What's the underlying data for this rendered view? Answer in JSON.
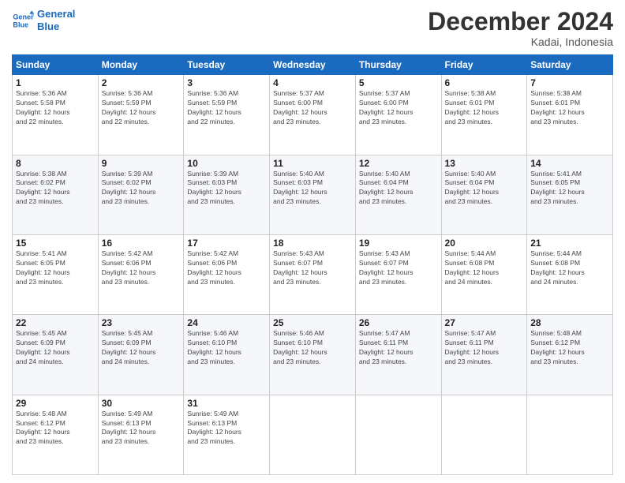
{
  "logo": {
    "line1": "General",
    "line2": "Blue"
  },
  "title": "December 2024",
  "location": "Kadai, Indonesia",
  "days_header": [
    "Sunday",
    "Monday",
    "Tuesday",
    "Wednesday",
    "Thursday",
    "Friday",
    "Saturday"
  ],
  "weeks": [
    [
      {
        "day": "1",
        "info": "Sunrise: 5:36 AM\nSunset: 5:58 PM\nDaylight: 12 hours\nand 22 minutes."
      },
      {
        "day": "2",
        "info": "Sunrise: 5:36 AM\nSunset: 5:59 PM\nDaylight: 12 hours\nand 22 minutes."
      },
      {
        "day": "3",
        "info": "Sunrise: 5:36 AM\nSunset: 5:59 PM\nDaylight: 12 hours\nand 22 minutes."
      },
      {
        "day": "4",
        "info": "Sunrise: 5:37 AM\nSunset: 6:00 PM\nDaylight: 12 hours\nand 23 minutes."
      },
      {
        "day": "5",
        "info": "Sunrise: 5:37 AM\nSunset: 6:00 PM\nDaylight: 12 hours\nand 23 minutes."
      },
      {
        "day": "6",
        "info": "Sunrise: 5:38 AM\nSunset: 6:01 PM\nDaylight: 12 hours\nand 23 minutes."
      },
      {
        "day": "7",
        "info": "Sunrise: 5:38 AM\nSunset: 6:01 PM\nDaylight: 12 hours\nand 23 minutes."
      }
    ],
    [
      {
        "day": "8",
        "info": "Sunrise: 5:38 AM\nSunset: 6:02 PM\nDaylight: 12 hours\nand 23 minutes."
      },
      {
        "day": "9",
        "info": "Sunrise: 5:39 AM\nSunset: 6:02 PM\nDaylight: 12 hours\nand 23 minutes."
      },
      {
        "day": "10",
        "info": "Sunrise: 5:39 AM\nSunset: 6:03 PM\nDaylight: 12 hours\nand 23 minutes."
      },
      {
        "day": "11",
        "info": "Sunrise: 5:40 AM\nSunset: 6:03 PM\nDaylight: 12 hours\nand 23 minutes."
      },
      {
        "day": "12",
        "info": "Sunrise: 5:40 AM\nSunset: 6:04 PM\nDaylight: 12 hours\nand 23 minutes."
      },
      {
        "day": "13",
        "info": "Sunrise: 5:40 AM\nSunset: 6:04 PM\nDaylight: 12 hours\nand 23 minutes."
      },
      {
        "day": "14",
        "info": "Sunrise: 5:41 AM\nSunset: 6:05 PM\nDaylight: 12 hours\nand 23 minutes."
      }
    ],
    [
      {
        "day": "15",
        "info": "Sunrise: 5:41 AM\nSunset: 6:05 PM\nDaylight: 12 hours\nand 23 minutes."
      },
      {
        "day": "16",
        "info": "Sunrise: 5:42 AM\nSunset: 6:06 PM\nDaylight: 12 hours\nand 23 minutes."
      },
      {
        "day": "17",
        "info": "Sunrise: 5:42 AM\nSunset: 6:06 PM\nDaylight: 12 hours\nand 23 minutes."
      },
      {
        "day": "18",
        "info": "Sunrise: 5:43 AM\nSunset: 6:07 PM\nDaylight: 12 hours\nand 23 minutes."
      },
      {
        "day": "19",
        "info": "Sunrise: 5:43 AM\nSunset: 6:07 PM\nDaylight: 12 hours\nand 23 minutes."
      },
      {
        "day": "20",
        "info": "Sunrise: 5:44 AM\nSunset: 6:08 PM\nDaylight: 12 hours\nand 24 minutes."
      },
      {
        "day": "21",
        "info": "Sunrise: 5:44 AM\nSunset: 6:08 PM\nDaylight: 12 hours\nand 24 minutes."
      }
    ],
    [
      {
        "day": "22",
        "info": "Sunrise: 5:45 AM\nSunset: 6:09 PM\nDaylight: 12 hours\nand 24 minutes."
      },
      {
        "day": "23",
        "info": "Sunrise: 5:45 AM\nSunset: 6:09 PM\nDaylight: 12 hours\nand 24 minutes."
      },
      {
        "day": "24",
        "info": "Sunrise: 5:46 AM\nSunset: 6:10 PM\nDaylight: 12 hours\nand 23 minutes."
      },
      {
        "day": "25",
        "info": "Sunrise: 5:46 AM\nSunset: 6:10 PM\nDaylight: 12 hours\nand 23 minutes."
      },
      {
        "day": "26",
        "info": "Sunrise: 5:47 AM\nSunset: 6:11 PM\nDaylight: 12 hours\nand 23 minutes."
      },
      {
        "day": "27",
        "info": "Sunrise: 5:47 AM\nSunset: 6:11 PM\nDaylight: 12 hours\nand 23 minutes."
      },
      {
        "day": "28",
        "info": "Sunrise: 5:48 AM\nSunset: 6:12 PM\nDaylight: 12 hours\nand 23 minutes."
      }
    ],
    [
      {
        "day": "29",
        "info": "Sunrise: 5:48 AM\nSunset: 6:12 PM\nDaylight: 12 hours\nand 23 minutes."
      },
      {
        "day": "30",
        "info": "Sunrise: 5:49 AM\nSunset: 6:13 PM\nDaylight: 12 hours\nand 23 minutes."
      },
      {
        "day": "31",
        "info": "Sunrise: 5:49 AM\nSunset: 6:13 PM\nDaylight: 12 hours\nand 23 minutes."
      },
      {
        "day": "",
        "info": ""
      },
      {
        "day": "",
        "info": ""
      },
      {
        "day": "",
        "info": ""
      },
      {
        "day": "",
        "info": ""
      }
    ]
  ]
}
